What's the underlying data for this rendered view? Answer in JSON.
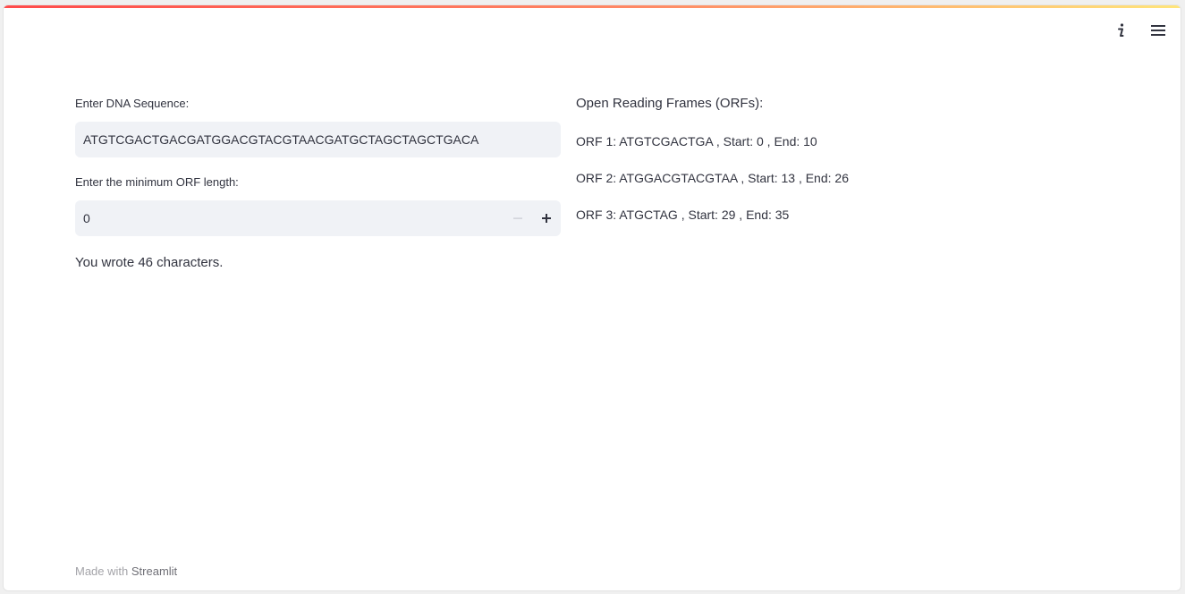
{
  "toolbar": {
    "info_icon": "info-icon",
    "menu_icon": "hamburger-menu-icon"
  },
  "inputs": {
    "dna_label": "Enter DNA Sequence:",
    "dna_value": "ATGTCGACTGACGATGGACGTACGTAACGATGCTAGCTAGCTGACA",
    "min_orf_label": "Enter the minimum ORF length:",
    "min_orf_value": "0",
    "minus_symbol": "−",
    "plus_symbol": "+"
  },
  "char_count_text": "You wrote 46 characters.",
  "orfs": {
    "title": "Open Reading Frames (ORFs):",
    "items": [
      "ORF 1: ATGTCGACTGA , Start: 0 , End: 10",
      "ORF 2: ATGGACGTACGTAA , Start: 13 , End: 26",
      "ORF 3: ATGCTAG , Start: 29 , End: 35"
    ]
  },
  "footer": {
    "prefix": "Made with ",
    "link": "Streamlit"
  },
  "colors": {
    "accent": "#ff4b4b",
    "input_bg": "#f0f2f6",
    "text": "#31333f"
  }
}
